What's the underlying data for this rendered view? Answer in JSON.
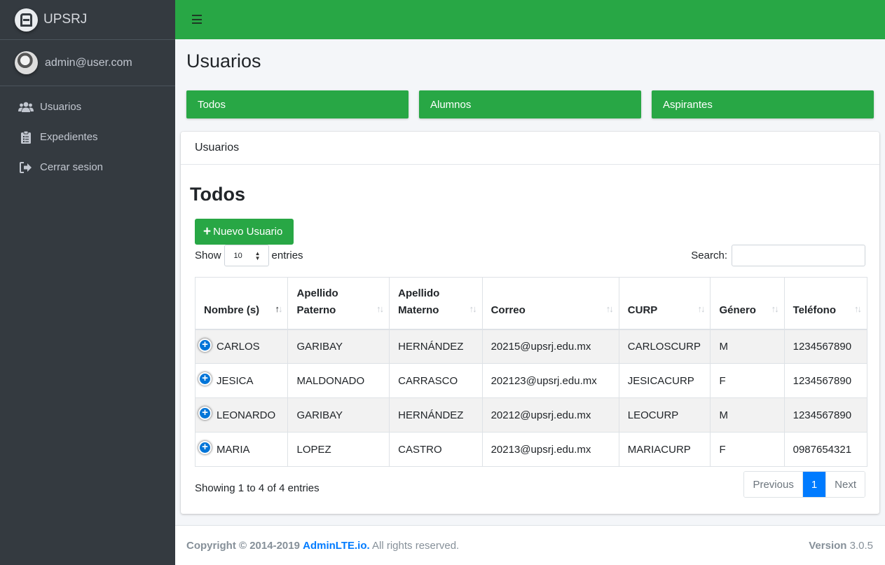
{
  "brand": {
    "name": "UPSRJ"
  },
  "user": {
    "email": "admin@user.com"
  },
  "sidebar": {
    "items": [
      {
        "label": "Usuarios",
        "icon": "users-icon"
      },
      {
        "label": "Expedientes",
        "icon": "clipboard-icon"
      },
      {
        "label": "Cerrar sesion",
        "icon": "sign-out-icon"
      }
    ]
  },
  "page": {
    "title": "Usuarios",
    "filters": [
      "Todos",
      "Alumnos",
      "Aspirantes"
    ]
  },
  "card": {
    "header": "Usuarios",
    "section_title": "Todos",
    "new_button": "Nuevo Usuario",
    "show_label": "Show",
    "entries_label": "entries",
    "page_length": "10",
    "search_label": "Search:",
    "search_value": ""
  },
  "table": {
    "columns": [
      "Nombre (s)",
      "Apellido Paterno",
      "Apellido Materno",
      "Correo",
      "CURP",
      "Género",
      "Teléfono"
    ],
    "rows": [
      [
        "CARLOS",
        "GARIBAY",
        "HERNÁNDEZ",
        "20215@upsrj.edu.mx",
        "CARLOSCURP",
        "M",
        "1234567890"
      ],
      [
        "JESICA",
        "MALDONADO",
        "CARRASCO",
        "202123@upsrj.edu.mx",
        "JESICACURP",
        "F",
        "1234567890"
      ],
      [
        "LEONARDO",
        "GARIBAY",
        "HERNÁNDEZ",
        "20212@upsrj.edu.mx",
        "LEOCURP",
        "M",
        "1234567890"
      ],
      [
        "MARIA",
        "LOPEZ",
        "CASTRO",
        "20213@upsrj.edu.mx",
        "MARIACURP",
        "F",
        "0987654321"
      ]
    ],
    "info": "Showing 1 to 4 of 4 entries",
    "pagination": {
      "previous": "Previous",
      "current": "1",
      "next": "Next"
    }
  },
  "footer": {
    "copyright": "Copyright © 2014-2019",
    "link": "AdminLTE.io.",
    "rights": "All rights reserved.",
    "version_label": "Version",
    "version": "3.0.5"
  },
  "colors": {
    "accent": "#28a745",
    "sidebar": "#343a40",
    "primary": "#007bff"
  }
}
